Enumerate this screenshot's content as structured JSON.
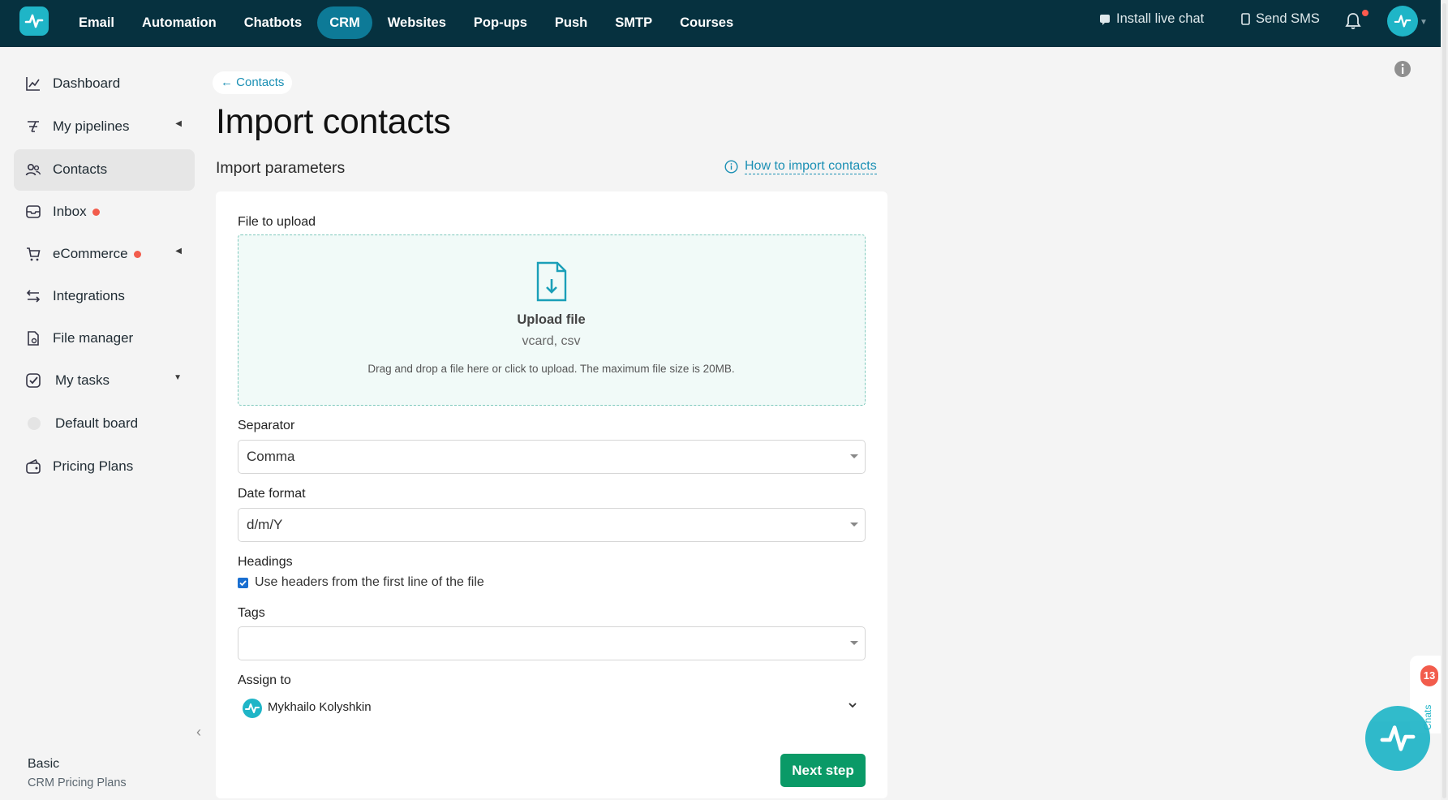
{
  "colors": {
    "topbar": "#06313f",
    "accent": "#1fb5c7",
    "link": "#1a8fb4",
    "primary_button": "#0a9a67",
    "alert": "#f25c4c"
  },
  "nav": {
    "items": [
      {
        "label": "Email"
      },
      {
        "label": "Automation"
      },
      {
        "label": "Chatbots"
      },
      {
        "label": "CRM",
        "active": true
      },
      {
        "label": "Websites"
      },
      {
        "label": "Pop-ups"
      },
      {
        "label": "Push"
      },
      {
        "label": "SMTP"
      },
      {
        "label": "Courses"
      }
    ],
    "install_live_chat": "Install live chat",
    "send_sms": "Send SMS"
  },
  "sidebar": {
    "items": [
      {
        "label": "Dashboard",
        "icon": "chart-line-icon"
      },
      {
        "label": "My pipelines",
        "icon": "pipeline-icon"
      },
      {
        "label": "Contacts",
        "icon": "users-icon",
        "active": true
      },
      {
        "label": "Inbox",
        "icon": "inbox-icon"
      },
      {
        "label": "eCommerce",
        "icon": "cart-icon"
      },
      {
        "label": "Integrations",
        "icon": "arrows-icon"
      },
      {
        "label": "File manager",
        "icon": "file-icon"
      },
      {
        "label": "My tasks",
        "icon": "check-square-icon"
      },
      {
        "label": "Default board",
        "icon": "circle-icon"
      },
      {
        "label": "Pricing Plans",
        "icon": "wallet-icon"
      }
    ],
    "plan_name": "Basic",
    "plan_sub": "CRM Pricing Plans"
  },
  "main": {
    "breadcrumb": "← Contacts",
    "title": "Import contacts",
    "section_title": "Import parameters",
    "howto_link": "How to import contacts",
    "file_label": "File to upload",
    "upload_title": "Upload file",
    "upload_formats": "vcard, csv",
    "upload_hint": "Drag and drop a file here or click to upload. The maximum file size is 20MB.",
    "separator_label": "Separator",
    "separator_value": "Comma",
    "date_format_label": "Date format",
    "date_format_value": "d/m/Y",
    "headings_label": "Headings",
    "headings_checkbox": "Use headers from the first line of the file",
    "headings_checked": true,
    "tags_label": "Tags",
    "tags_value": "",
    "assign_label": "Assign to",
    "assign_value": "Mykhailo Kolyshkin",
    "next_button": "Next step"
  },
  "chat_widget": {
    "badge": "13",
    "label": "Chats"
  }
}
